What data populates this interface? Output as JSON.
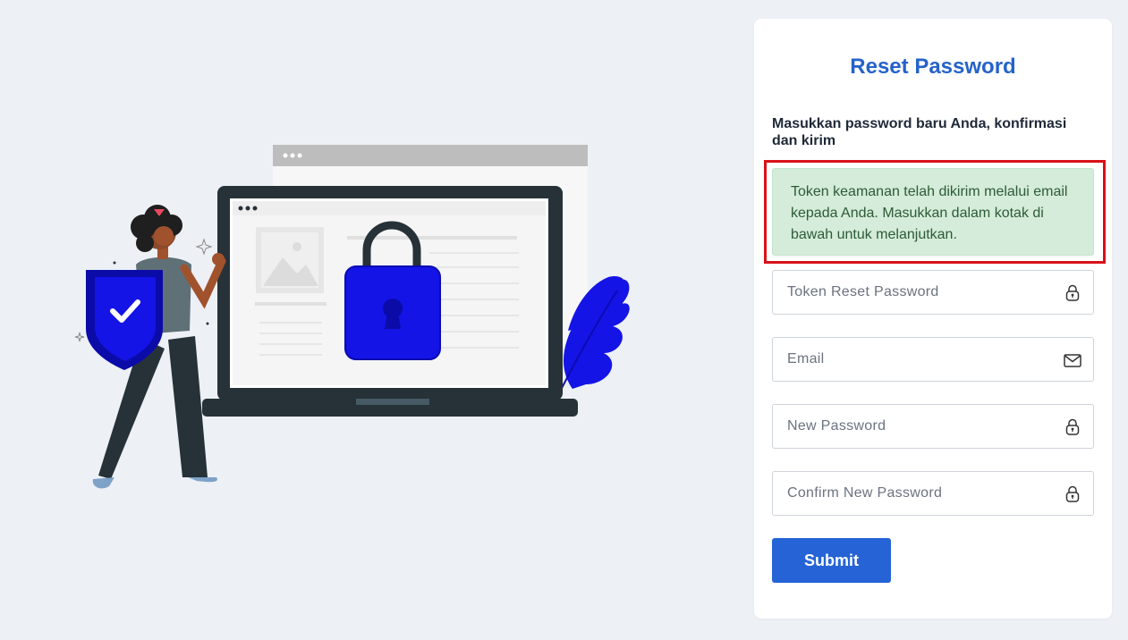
{
  "form": {
    "title": "Reset Password",
    "instruction": "Masukkan password baru Anda, konfirmasi dan kirim",
    "alert_text": "Token keamanan telah dikirim melalui email kepada Anda. Masukkan dalam kotak di bawah untuk melanjutkan.",
    "fields": [
      {
        "placeholder": "Token Reset Password",
        "value": "",
        "icon": "lock-icon"
      },
      {
        "placeholder": "Email",
        "value": "",
        "icon": "envelope-icon"
      },
      {
        "placeholder": "New Password",
        "value": "",
        "icon": "lock-icon"
      },
      {
        "placeholder": "Confirm New Password",
        "value": "",
        "icon": "lock-icon"
      }
    ],
    "submit_label": "Submit"
  },
  "colors": {
    "page_bg": "#edf0f5",
    "title": "#2563c9",
    "button": "#2563d6",
    "alert_bg": "#d4ecd9",
    "alert_text": "#2d5b38",
    "highlight_border": "#d9111a",
    "illustration_accent": "#1414e6"
  }
}
